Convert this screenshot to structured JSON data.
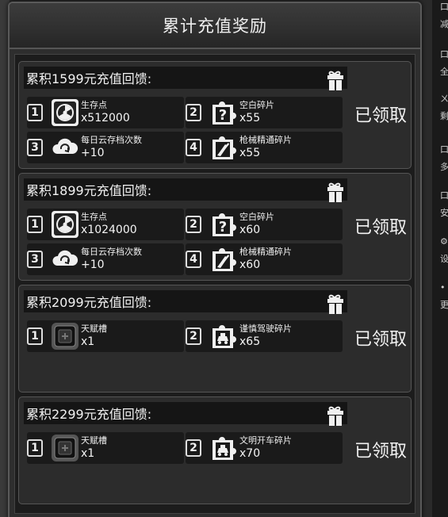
{
  "title": "累计充值奖励",
  "cards": [
    {
      "heading": "累积1599元充值回馈:",
      "status": "已领取",
      "rewards": [
        {
          "index": "1",
          "icon": "radiation-icon",
          "name": "生存点",
          "qty": "x512000"
        },
        {
          "index": "2",
          "icon": "question-puzzle-icon",
          "name": "空白碎片",
          "qty": "x55"
        },
        {
          "index": "3",
          "icon": "cloud-icon",
          "name": "每日云存档次数",
          "qty": "+10"
        },
        {
          "index": "4",
          "icon": "gun-puzzle-icon",
          "name": "枪械精通碎片",
          "qty": "x55"
        }
      ]
    },
    {
      "heading": "累积1899元充值回馈:",
      "status": "已领取",
      "rewards": [
        {
          "index": "1",
          "icon": "radiation-icon",
          "name": "生存点",
          "qty": "x1024000"
        },
        {
          "index": "2",
          "icon": "question-puzzle-icon",
          "name": "空白碎片",
          "qty": "x60"
        },
        {
          "index": "3",
          "icon": "cloud-icon",
          "name": "每日云存档次数",
          "qty": "+10"
        },
        {
          "index": "4",
          "icon": "gun-puzzle-icon",
          "name": "枪械精通碎片",
          "qty": "x60"
        }
      ]
    },
    {
      "heading": "累积2099元充值回馈:",
      "status": "已领取",
      "rewards": [
        {
          "index": "1",
          "icon": "talent-slot-icon",
          "name": "天赋槽",
          "qty": "x1"
        },
        {
          "index": "2",
          "icon": "car-puzzle-icon",
          "name": "谨慎驾驶碎片",
          "qty": "x65"
        }
      ]
    },
    {
      "heading": "累积2299元充值回馈:",
      "status": "已领取",
      "rewards": [
        {
          "index": "1",
          "icon": "talent-slot-icon",
          "name": "天赋槽",
          "qty": "x1"
        },
        {
          "index": "2",
          "icon": "car-puzzle-icon",
          "name": "文明开车碎片",
          "qty": "x70"
        }
      ]
    }
  ],
  "side_chars": [
    "口",
    "减",
    "口",
    "全",
    "ㄨ",
    "剩",
    "口",
    "多",
    "口",
    "安",
    "⚙",
    "设",
    "•",
    "更"
  ]
}
